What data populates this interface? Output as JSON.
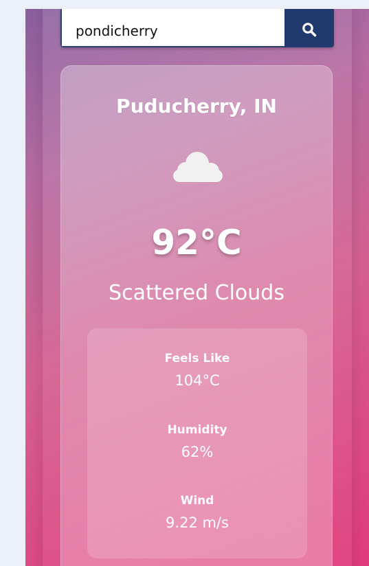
{
  "search": {
    "value": "pondicherry",
    "button_icon": "search-icon"
  },
  "weather": {
    "city": "Puducherry, IN",
    "icon": "cloud-icon",
    "temperature": "92°C",
    "description": "Scattered Clouds",
    "details": [
      {
        "label": "Feels Like",
        "value": "104°C"
      },
      {
        "label": "Humidity",
        "value": "62%"
      },
      {
        "label": "Wind",
        "value": "9.22 m/s"
      }
    ]
  },
  "colors": {
    "page_background": "#ebeff8",
    "search_button": "#203a6e",
    "gradient_start": "#8a5f9e",
    "gradient_end": "#e03c7a"
  }
}
